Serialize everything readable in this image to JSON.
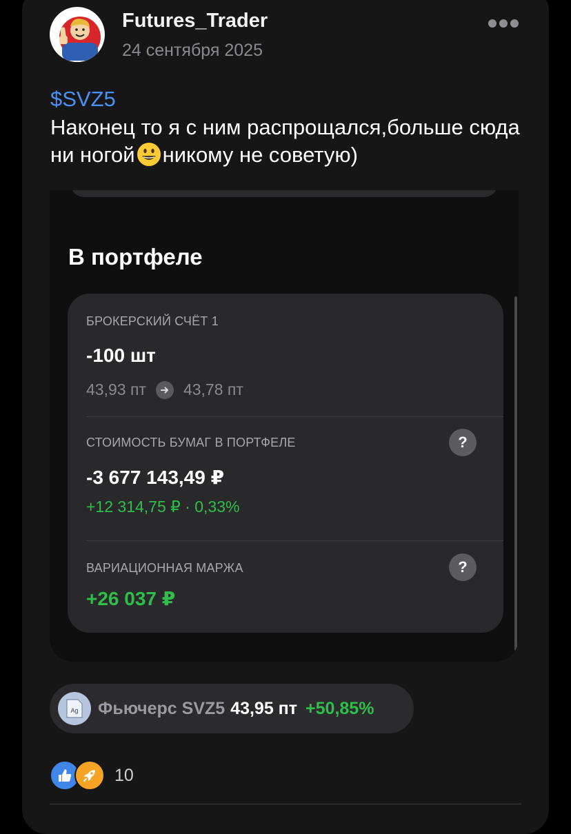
{
  "post": {
    "author": "Futures_Trader",
    "date": "24 сентября 2025",
    "ticker": "$SVZ5",
    "text_before_emoji": "Наконец то я с ним распрощался,больше сюда ни ногой",
    "emoji": "grinning-face",
    "text_after_emoji": "никому не советую)"
  },
  "screenshot": {
    "title": "В портфеле",
    "account_label": "БРОКЕРСКИЙ СЧЁТ 1",
    "quantity": "-100 шт",
    "price_from": "43,93 пт",
    "price_to": "43,78 пт",
    "value_label": "СТОИМОСТЬ БУМАГ В ПОРТФЕЛЕ",
    "value": "-3 677 143,49 ₽",
    "value_change": "+12 314,75 ₽ · 0,33%",
    "margin_label": "ВАРИАЦИОННАЯ МАРЖА",
    "margin_value": "+26 037 ₽",
    "help_glyph": "?"
  },
  "instrument": {
    "icon_text": "Ag",
    "name": "Фьючерс SVZ5",
    "price": "43,95 пт",
    "change": "+50,85%"
  },
  "reactions": {
    "icons": [
      "like-icon",
      "rocket-icon"
    ],
    "count": "10"
  },
  "colors": {
    "link": "#4a90f5",
    "positive": "#2fbe4b",
    "card": "#161616",
    "panel": "#29292b"
  }
}
